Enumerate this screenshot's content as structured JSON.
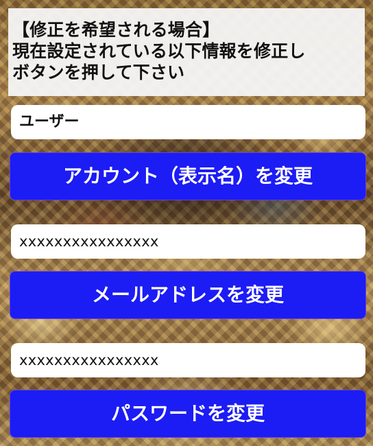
{
  "notice": {
    "line1": "【修正を希望される場合】",
    "line2": "現在設定されている以下情報を修正し",
    "line3": "ボタンを押して下さい"
  },
  "account": {
    "value": "ユーザー",
    "button_label": "アカウント（表示名）を変更"
  },
  "email": {
    "value": "xxxxxxxxxxxxxxxx",
    "button_label": "メールアドレスを変更"
  },
  "password": {
    "value": "xxxxxxxxxxxxxxxx",
    "button_label": "パスワードを変更"
  },
  "colors": {
    "button_blue": "#1c1cf4",
    "notice_bg": "#f5f5f5"
  }
}
